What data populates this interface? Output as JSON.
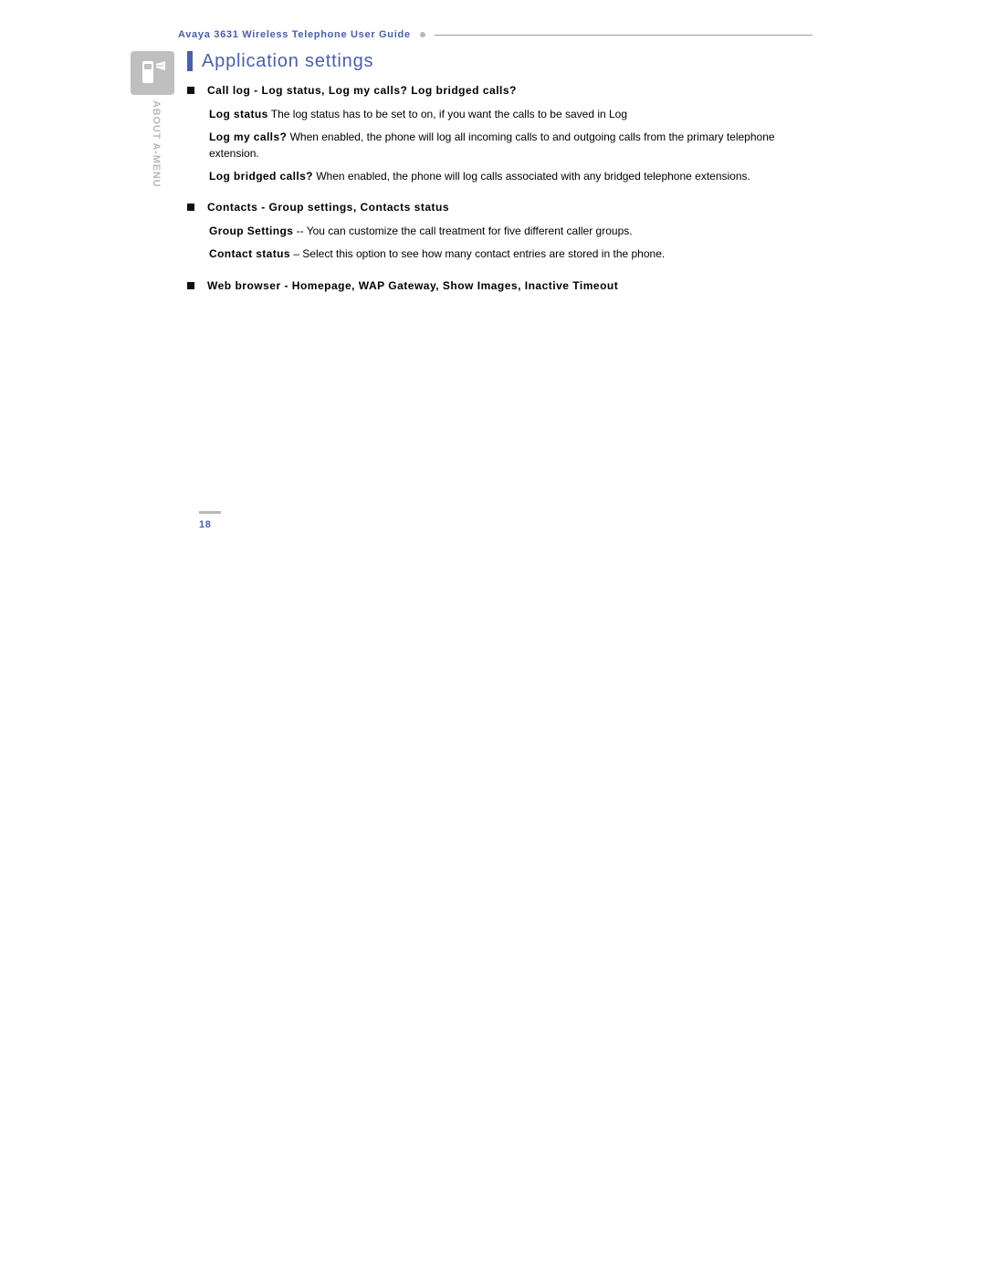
{
  "header": {
    "doc_title": "Avaya 3631 Wireless Telephone User Guide"
  },
  "side": {
    "section_label": "ABOUT A-MENU"
  },
  "main": {
    "title": "Application settings",
    "items": [
      {
        "heading": "Call log - Log status, Log my calls? Log bridged calls?",
        "paras": [
          {
            "term": "Log status",
            "text": " The log status has to be set to on, if you want the calls to be saved in Log"
          },
          {
            "term": "Log my calls?",
            "text": "   When enabled, the phone will log all incoming calls to and outgoing calls from the primary telephone extension."
          },
          {
            "term": "Log bridged calls?",
            "text": "   When enabled, the phone will log calls associated with any bridged telephone extensions."
          }
        ]
      },
      {
        "heading": "Contacts - Group settings, Contacts status",
        "paras": [
          {
            "term": "Group Settings",
            "text": " -- You can customize the call treatment for five different caller groups."
          },
          {
            "term": "Contact status",
            "text": " – Select this option to see how many contact entries are stored in the phone."
          }
        ]
      },
      {
        "heading": "Web browser - Homepage, WAP Gateway, Show Images, Inactive Timeout",
        "paras": []
      }
    ]
  },
  "page_number": "18"
}
